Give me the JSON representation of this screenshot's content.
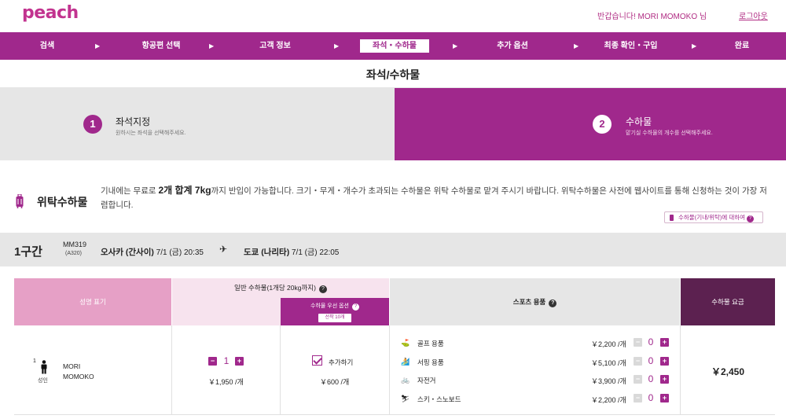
{
  "header": {
    "logo": "peach",
    "greeting": "반갑습니다! MORI MOMOKO 님",
    "logout": "로그아웃"
  },
  "steps": [
    "검색",
    "항공편 선택",
    "고객 정보",
    "좌석・수하물",
    "추가 옵션",
    "최종 확인・구입",
    "완료"
  ],
  "page_title": "좌석/수하물",
  "subtabs": {
    "seat": {
      "num": "1",
      "title": "좌석지정",
      "desc": "원하시는 좌석을 선택해주세요."
    },
    "baggage": {
      "num": "2",
      "title": "수하물",
      "desc": "맡기실 수하물의 개수를 선택해주세요."
    }
  },
  "info": {
    "title": "위탁수하물",
    "text_pre": "기내에는 무료로 ",
    "text_bold": "2개 합계 7kg",
    "text_post": "까지 반입이 가능합니다. 크기・무게・개수가 초과되는 수하물은 위탁 수하물로 맡겨 주시기 바랍니다. 위탁수하물은 사전에 웹사이트를 통해 신청하는 것이 가장 저렴합니다.",
    "link": "수하물(기내/위탁)에 대하여"
  },
  "segment": {
    "label": "1구간",
    "flight_no": "MM319",
    "aircraft": "(A320)",
    "from": "오사카 (간사이)",
    "from_time": "7/1 (금) 20:35",
    "to": "도쿄 (나리타)",
    "to_time": "7/1 (금) 22:05"
  },
  "table": {
    "headers": {
      "name": "성명 표기",
      "general": "일반 수하물(1개당 20kg까지)",
      "priority": "수하물 우선 옵션",
      "priority_chip": "선착 10개",
      "sports": "스포츠 용품",
      "fee": "수하물 요금"
    },
    "passenger": {
      "index": "1",
      "type": "성인",
      "name_line1": "MORI",
      "name_line2": "MOMOKO"
    },
    "general": {
      "minus": "−",
      "plus": "+",
      "count": "1",
      "price": "￥1,950 /개"
    },
    "priority": {
      "label": "추가하기",
      "checked": true,
      "price": "￥600 /개"
    },
    "sports": [
      {
        "icon": "golf-icon",
        "name": "골프 용품",
        "price": "￥2,200 /개",
        "count": "0"
      },
      {
        "icon": "surf-icon",
        "name": "서핑 용품",
        "price": "￥5,100 /개",
        "count": "0"
      },
      {
        "icon": "bicycle-icon",
        "name": "자전거",
        "price": "￥3,900 /개",
        "count": "0"
      },
      {
        "icon": "ski-icon",
        "name": "스키・스노보드",
        "price": "￥2,200 /개",
        "count": "0"
      }
    ],
    "total": "￥2,450"
  },
  "colors": {
    "brand": "#a0288c",
    "brand_dark": "#5c2150",
    "pink": "#e6a0c6",
    "light_pink": "#f7e3ee",
    "gray": "#e6e6e6"
  }
}
